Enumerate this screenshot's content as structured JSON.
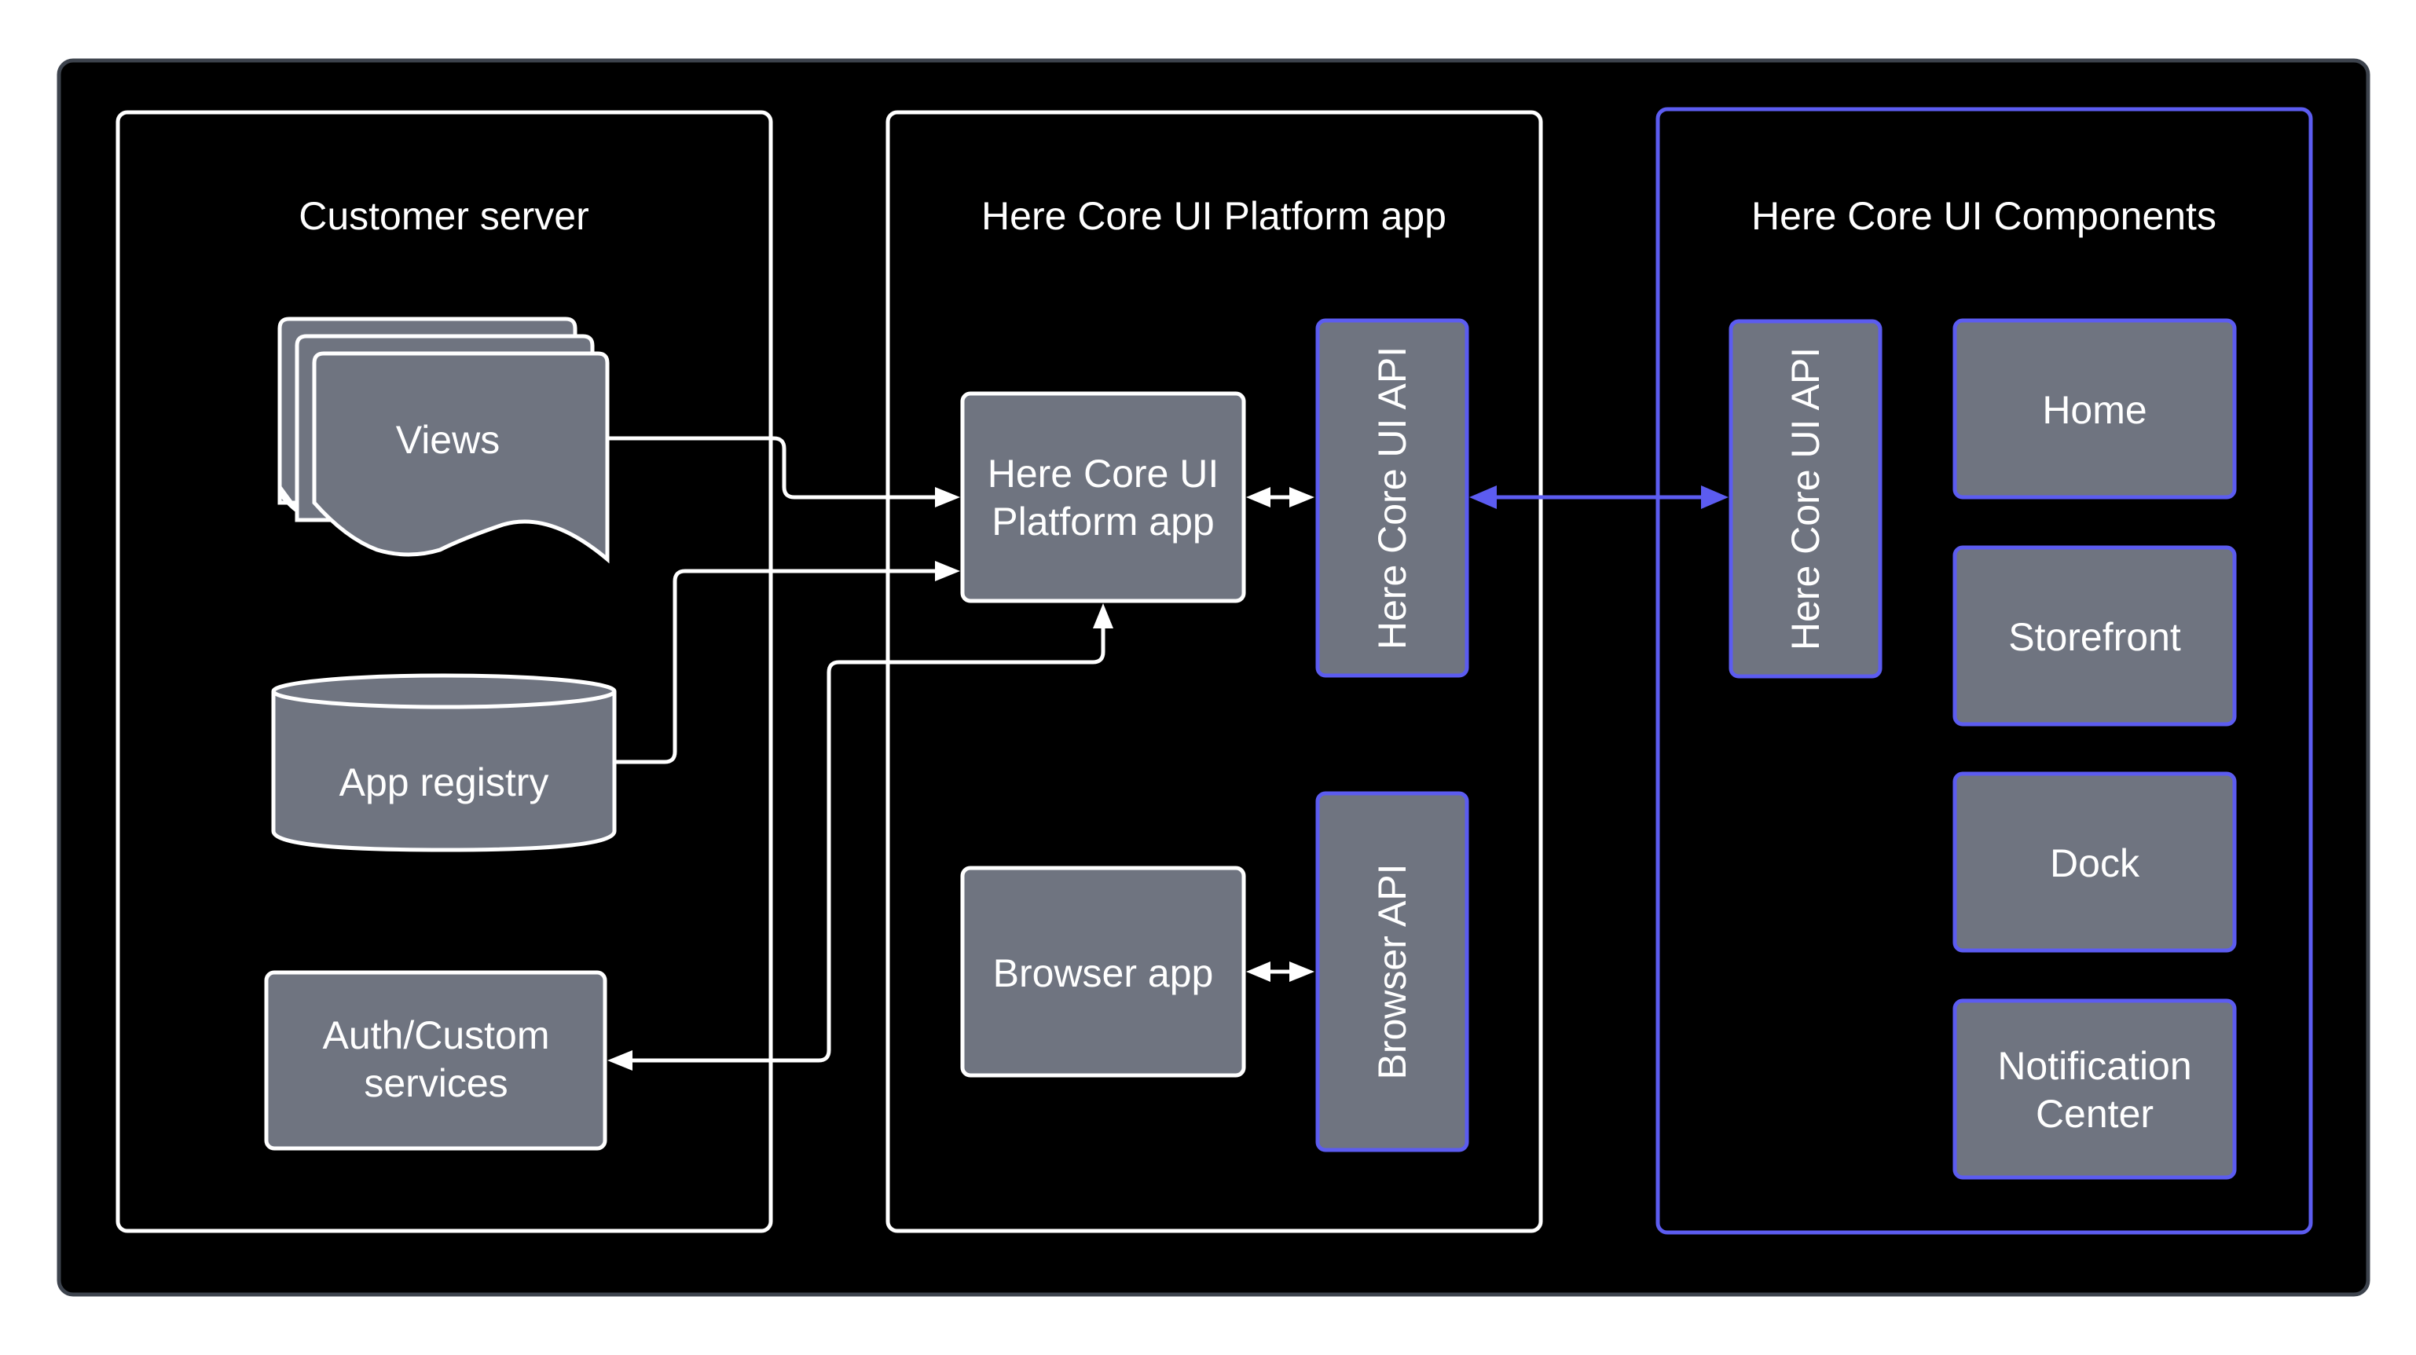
{
  "diagram": {
    "colors": {
      "background": "#000000",
      "frame_border": "#3d434d",
      "node_fill": "#6f7480",
      "node_border": "#ffffff",
      "accent": "#5c5cf0",
      "text": "#ffffff",
      "page_background": "#ffffff"
    },
    "groups": {
      "customer_server": {
        "title": "Customer server",
        "nodes": {
          "views": "Views",
          "app_registry": "App registry",
          "auth_line1": "Auth/Custom",
          "auth_line2": "services"
        }
      },
      "platform_app": {
        "title": "Here Core UI Platform app",
        "nodes": {
          "platform_line1": "Here Core UI",
          "platform_line2": "Platform app",
          "core_api": "Here Core UI API",
          "browser_app": "Browser app",
          "browser_api": "Browser API"
        }
      },
      "components": {
        "title": "Here Core UI Components",
        "nodes": {
          "core_api": "Here Core UI API",
          "home": "Home",
          "storefront": "Storefront",
          "dock": "Dock",
          "notification_line1": "Notification",
          "notification_line2": "Center"
        }
      }
    },
    "edges": [
      {
        "from": "Views",
        "to": "Here Core UI Platform app",
        "direction": "forward"
      },
      {
        "from": "App registry",
        "to": "Here Core UI Platform app",
        "direction": "forward"
      },
      {
        "from": "Here Core UI Platform app",
        "to": "Auth/Custom services",
        "direction": "both"
      },
      {
        "from": "Here Core UI Platform app",
        "to": "Here Core UI API",
        "direction": "both"
      },
      {
        "from": "Browser app",
        "to": "Browser API",
        "direction": "both"
      },
      {
        "from": "Here Core UI API (platform)",
        "to": "Here Core UI API (components)",
        "direction": "both",
        "accent": true
      }
    ]
  }
}
